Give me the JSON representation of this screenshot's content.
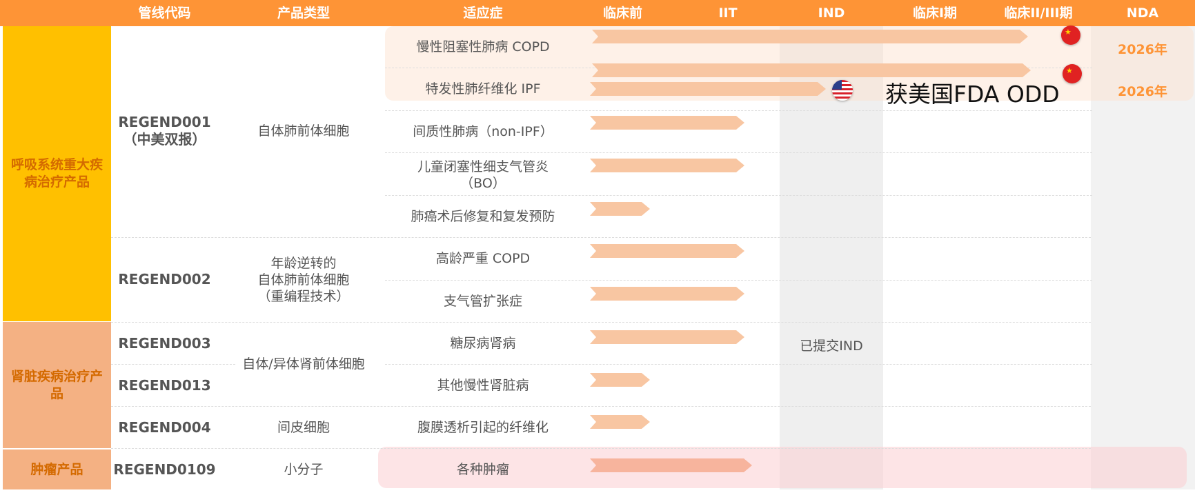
{
  "header": [
    "管线代码",
    "产品类型",
    "适应症",
    "临床前",
    "IIT",
    "IND",
    "临床I期",
    "临床II/III期",
    "NDA"
  ],
  "categories": {
    "respiratory": "呼吸系统重大疾病治疗产品",
    "kidney": "肾脏疾病治疗产品",
    "oncology": "肿瘤产品"
  },
  "products": {
    "p1": {
      "code_line1": "REGEND001",
      "code_line2": "（中美双报）",
      "type": "自体肺前体细胞"
    },
    "p2": {
      "code": "REGEND002",
      "type_lines": [
        "年龄逆转的",
        "自体肺前体细胞",
        "（重编程技术）"
      ]
    },
    "p3": {
      "code": "REGEND003"
    },
    "p13": {
      "code": "REGEND013"
    },
    "p34": {
      "type": "自体/异体肾前体细胞"
    },
    "p4": {
      "code": "REGEND004",
      "type": "间皮细胞"
    },
    "p109": {
      "code": "REGEND0109",
      "type": "小分子"
    }
  },
  "indications": [
    "慢性阻塞性肺病 COPD",
    "特发性肺纤维化 IPF",
    "间质性肺病（non-IPF）",
    "儿童闭塞性细支气管炎（BO）",
    "肺癌术后修复和复发预防",
    "高龄严重 COPD",
    "支气管扩张症",
    "糖尿病肾病",
    "其他慢性肾脏病",
    "腹膜透析引起的纤维化",
    "各种肿瘤"
  ],
  "ind_status": "已提交IND",
  "annotation_odd": "获美国FDA ODD",
  "nda": {
    "copd": "2026年",
    "ipf": "2026年"
  },
  "progress_stage": [
    {
      "indication": "慢性阻塞性肺病 COPD",
      "stage": "临床II/III期",
      "flag": "cn-flag"
    },
    {
      "indication": "特发性肺纤维化 IPF (CN)",
      "stage": "临床II/III期",
      "flag": "cn-flag"
    },
    {
      "indication": "特发性肺纤维化 IPF (US)",
      "stage": "IND",
      "flag": "us-flag"
    },
    {
      "indication": "间质性肺病（non-IPF）",
      "stage": "IIT"
    },
    {
      "indication": "儿童闭塞性细支气管炎（BO）",
      "stage": "IIT"
    },
    {
      "indication": "肺癌术后修复和复发预防",
      "stage": "临床前"
    },
    {
      "indication": "高龄严重 COPD",
      "stage": "IIT"
    },
    {
      "indication": "支气管扩张症",
      "stage": "IIT"
    },
    {
      "indication": "糖尿病肾病",
      "stage": "IIT"
    },
    {
      "indication": "其他慢性肾脏病",
      "stage": "临床前"
    },
    {
      "indication": "腹膜透析引起的纤维化",
      "stage": "临床前"
    },
    {
      "indication": "各种肿瘤",
      "stage": "IIT"
    }
  ],
  "colors": {
    "header": "#fe9436",
    "respiratory": "#ffc000",
    "kidney": "#f4b183",
    "bar": "#f8c6a2",
    "highlight": "#fdf0e6",
    "oncology_band": "#fde4e4",
    "nda_text": "#fe9436"
  }
}
